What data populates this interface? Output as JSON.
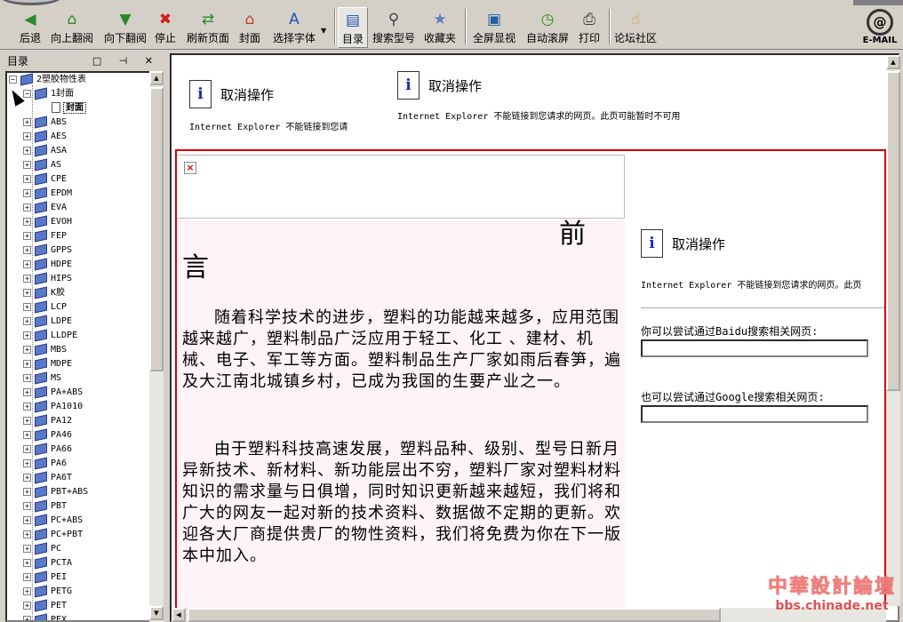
{
  "toolbar": {
    "buttons": [
      {
        "label": "后退",
        "icon": "back-arrow-icon",
        "glyph": "◀",
        "color": "#2a8a2a"
      },
      {
        "label": "向上翻阅",
        "icon": "home-up-icon",
        "glyph": "⌂",
        "color": "#2a8a2a"
      },
      {
        "label": "向下翻阅",
        "icon": "down-arrow-icon",
        "glyph": "▼",
        "color": "#2a8a2a"
      },
      {
        "label": "停止",
        "icon": "stop-icon",
        "glyph": "✖",
        "color": "#d02020"
      },
      {
        "label": "刷新页面",
        "icon": "refresh-icon",
        "glyph": "⇄",
        "color": "#2a8a2a"
      },
      {
        "label": "封面",
        "icon": "house-icon",
        "glyph": "⌂",
        "color": "#c04020"
      },
      {
        "label": "选择字体",
        "icon": "font-icon",
        "glyph": "A",
        "color": "#2050b0"
      },
      {
        "label": "目录",
        "icon": "toc-icon",
        "glyph": "▤",
        "color": "#2050b0"
      },
      {
        "label": "搜索型号",
        "icon": "magnifier-icon",
        "glyph": "⚲",
        "color": "#404040"
      },
      {
        "label": "收藏夹",
        "icon": "star-icon",
        "glyph": "★",
        "color": "#6080c0"
      },
      {
        "label": "全屏显视",
        "icon": "fullscreen-icon",
        "glyph": "▣",
        "color": "#2060a0"
      },
      {
        "label": "自动滚屏",
        "icon": "clock-icon",
        "glyph": "◷",
        "color": "#2a8a2a"
      },
      {
        "label": "打印",
        "icon": "printer-icon",
        "glyph": "⎙",
        "color": "#404040"
      },
      {
        "label": "论坛社区",
        "icon": "pointer-icon",
        "glyph": "☝",
        "color": "#d0a020"
      }
    ],
    "email_label": "E-MAIL"
  },
  "sidebar": {
    "title": "目录",
    "controls": "□ ⊣ ✕",
    "root": "2塑胶物性表",
    "cover_folder": "1封面",
    "cover_page": "封面",
    "items": [
      "ABS",
      "AES",
      "ASA",
      "AS",
      "CPE",
      "EPDM",
      "EVA",
      "EVOH",
      "FEP",
      "GPPS",
      "HDPE",
      "HIPS",
      "K胶",
      "LCP",
      "LDPE",
      "LLDPE",
      "MBS",
      "MDPE",
      "MS",
      "PA+ABS",
      "PA1010",
      "PA12",
      "PA46",
      "PA66",
      "PA6",
      "PA6T",
      "PBT+ABS",
      "PBT",
      "PC+ABS",
      "PC+PBT",
      "PC",
      "PCTA",
      "PEI",
      "PETG",
      "PET",
      "PEX"
    ]
  },
  "content": {
    "ie_title": "取消操作",
    "ie_sub_top1": "Internet Explorer 不能链接到您请",
    "ie_sub_top2": "Internet Explorer 不能链接到您请求的网页。此页可能暂时不可用",
    "ie_sub_side": "Internet Explorer 不能链接到您请求的网页。此页",
    "baidu_label": "你可以尝试通过Baidu搜索相关网页:",
    "google_label": "也可以尝试通过Google搜索相关网页:",
    "heading_1": "前",
    "heading_2": "言",
    "para1": "随着科学技术的进步，塑料的功能越来越多，应用范围越来越广，塑料制品广泛应用于轻工、化工 、建材、机械、电子、军工等方面。塑料制品生产厂家如雨后春笋，遍及大江南北城镇乡村，已成为我国的生要产业之一。",
    "para2": "由于塑料科技高速发展，塑料品种、级别、型号日新月异新技术、新材料、新功能层出不穷，塑料厂家对塑料材料知识的需求量与日俱增，同时知识更新越来越短，我们将和广大的网友一起对新的技术资料、数据做不定期的更新。欢迎各大厂商提供贵厂的物性资料，我们将免费为你在下一版本中加入。"
  },
  "watermark": {
    "line1": "中華設計論壇",
    "line2": "bbs.chinade.net"
  }
}
